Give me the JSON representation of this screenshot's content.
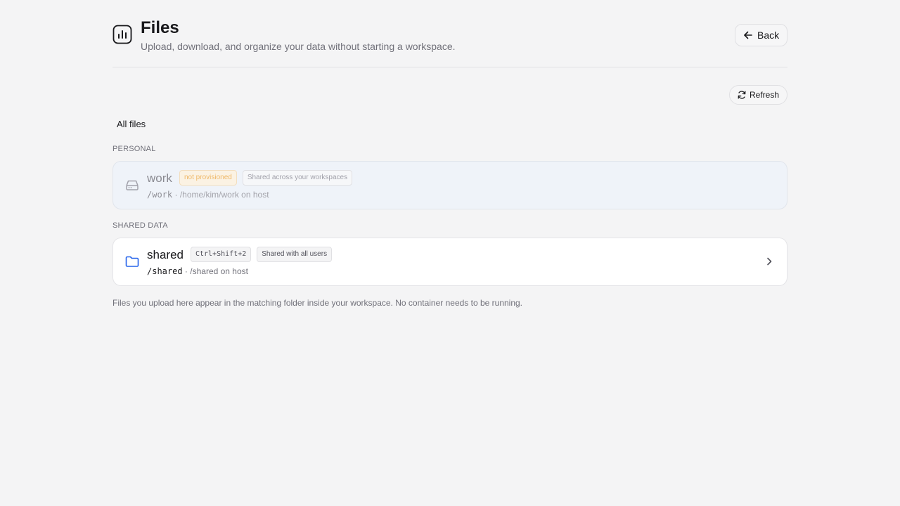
{
  "header": {
    "icon": "bar-chart-icon",
    "title": "Files",
    "subtitle": "Upload, download, and organize your data without starting a workspace.",
    "back_label": "Back"
  },
  "toolbar": {
    "refresh_label": "Refresh"
  },
  "filter": {
    "label": "All files"
  },
  "sections": {
    "personal": {
      "label": "PERSONAL",
      "item": {
        "name": "work",
        "status_badge": "not provisioned",
        "scope_badge": "Shared across your workspaces",
        "mount": "/work",
        "separator": "·",
        "host_path": "/home/kim/work on host",
        "icon": "hard-drive-icon"
      }
    },
    "shared": {
      "label": "SHARED DATA",
      "item": {
        "name": "shared",
        "shortcut_badge": "Ctrl+Shift+2",
        "scope_badge": "Shared with all users",
        "mount": "/shared",
        "separator": "·",
        "host_path": "/shared on host",
        "icon": "folder-icon"
      }
    }
  },
  "footnote": "Files you upload here appear in the matching folder inside your workspace. No container needs to be running.",
  "colors": {
    "background": "#f4f4f5",
    "folder_accent": "#2563eb",
    "warning_badge": "#efb96a"
  }
}
